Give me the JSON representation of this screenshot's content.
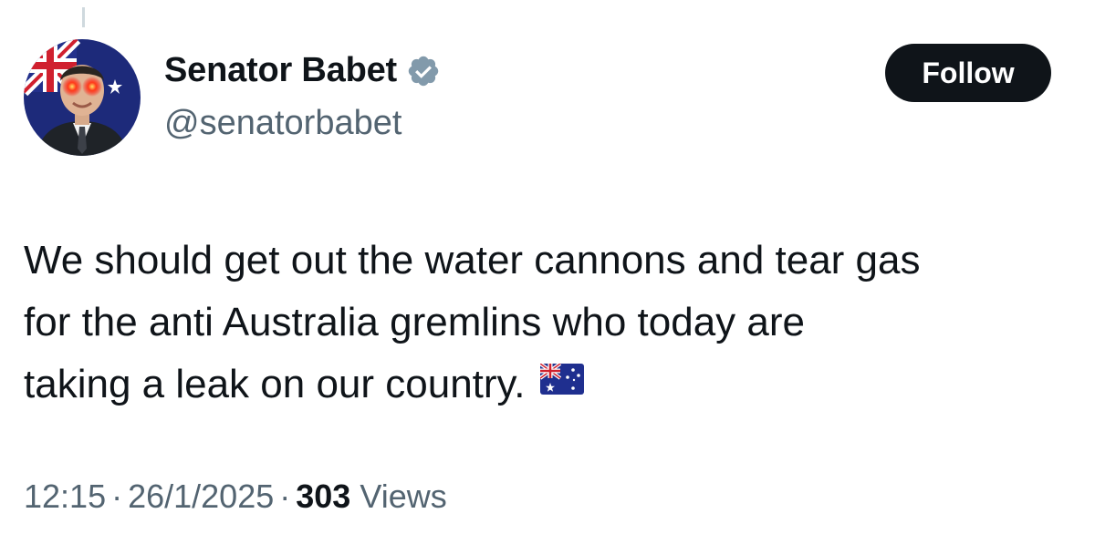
{
  "author": {
    "display_name": "Senator Babet",
    "handle": "@senatorbabet",
    "verified": true,
    "verified_icon": "verified-badge-icon",
    "avatar_icon": "avatar"
  },
  "follow_button": {
    "label": "Follow"
  },
  "tweet": {
    "lines": [
      "We should get out the water cannons and tear gas",
      "for the anti Australia gremlins who today are",
      "taking a leak on our country."
    ],
    "emoji": "australia-flag-emoji"
  },
  "meta": {
    "time": "12:15",
    "separator": "·",
    "date": "26/1/2025",
    "views_count": "303",
    "views_label": "Views"
  },
  "colors": {
    "text_primary": "#0f1419",
    "text_secondary": "#536471",
    "verified_badge": "#829aab",
    "follow_bg": "#0f1419",
    "background": "#ffffff"
  }
}
